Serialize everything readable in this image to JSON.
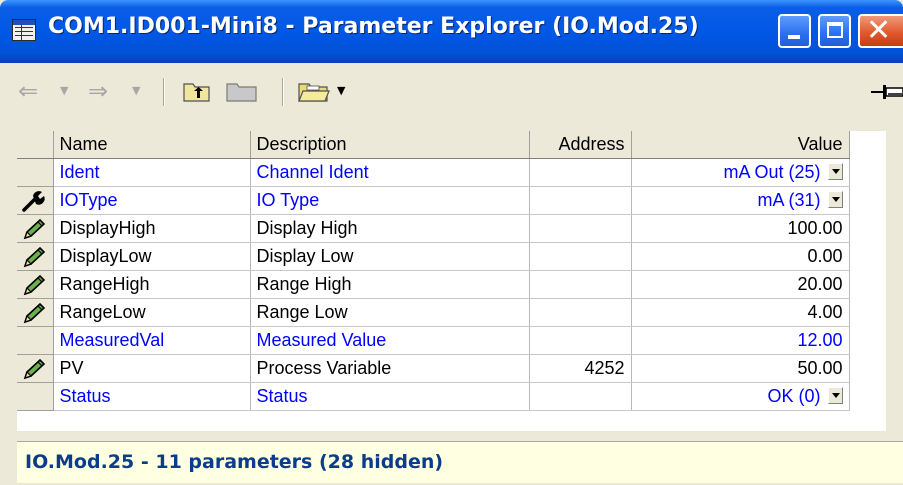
{
  "window": {
    "title": "COM1.ID001-Mini8 - Parameter Explorer (IO.Mod.25)",
    "buttons": {
      "minimize": "minimize",
      "maximize": "maximize",
      "close": "close"
    }
  },
  "toolbar": {
    "icons": [
      "back-arrow-icon",
      "dropdown-icon",
      "forward-arrow-icon",
      "dropdown-icon",
      "folder-up-icon",
      "folder-icon",
      "open-folder-icon",
      "dropdown-icon",
      "pin-icon"
    ]
  },
  "table": {
    "columns": {
      "name": "Name",
      "description": "Description",
      "address": "Address",
      "value": "Value"
    },
    "rows": [
      {
        "icon": "",
        "name": "Ident",
        "description": "Channel Ident",
        "address": "",
        "value": "mA Out (25)",
        "dropdown": true,
        "style": "blue"
      },
      {
        "icon": "wrench-icon",
        "name": "IOType",
        "description": "IO Type",
        "address": "",
        "value": "mA (31)",
        "dropdown": true,
        "style": "blue"
      },
      {
        "icon": "pencil-icon",
        "name": "DisplayHigh",
        "description": "Display High",
        "address": "",
        "value": "100.00",
        "dropdown": false,
        "style": "black"
      },
      {
        "icon": "pencil-icon",
        "name": "DisplayLow",
        "description": "Display Low",
        "address": "",
        "value": "0.00",
        "dropdown": false,
        "style": "black"
      },
      {
        "icon": "pencil-icon",
        "name": "RangeHigh",
        "description": "Range High",
        "address": "",
        "value": "20.00",
        "dropdown": false,
        "style": "black"
      },
      {
        "icon": "pencil-icon",
        "name": "RangeLow",
        "description": "Range Low",
        "address": "",
        "value": "4.00",
        "dropdown": false,
        "style": "black"
      },
      {
        "icon": "",
        "name": "MeasuredVal",
        "description": "Measured Value",
        "address": "",
        "value": "12.00",
        "dropdown": false,
        "style": "blue"
      },
      {
        "icon": "pencil-icon",
        "name": "PV",
        "description": "Process Variable",
        "address": "4252",
        "value": "50.00",
        "dropdown": false,
        "style": "black"
      },
      {
        "icon": "",
        "name": "Status",
        "description": "Status",
        "address": "",
        "value": "OK (0)",
        "dropdown": true,
        "style": "blue"
      }
    ]
  },
  "status": {
    "text": "IO.Mod.25  -  11 parameters (28 hidden)"
  }
}
